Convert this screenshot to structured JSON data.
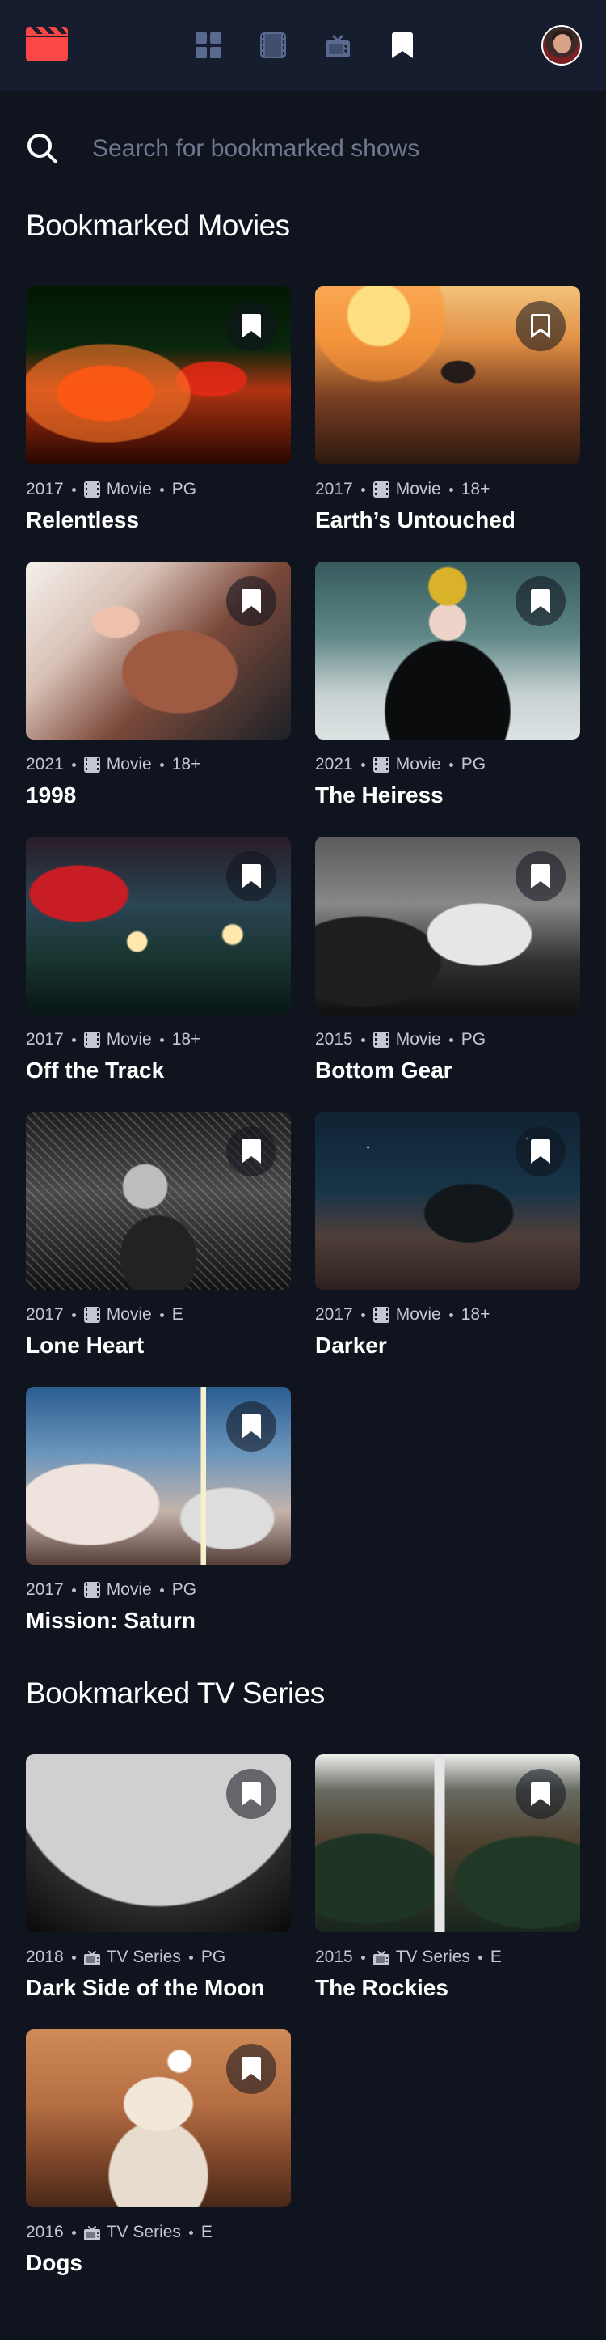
{
  "navigation": {
    "logo": "movie-app-logo",
    "items": [
      {
        "name": "home-icon",
        "active": false,
        "color": "#5A698F"
      },
      {
        "name": "movies-icon",
        "active": false,
        "color": "#5A698F"
      },
      {
        "name": "tv-series-icon",
        "active": false,
        "color": "#5A698F"
      },
      {
        "name": "bookmark-icon",
        "active": true,
        "color": "#FFFFFF"
      }
    ],
    "avatar": "profile-avatar"
  },
  "search": {
    "placeholder": "Search for bookmarked shows",
    "value": ""
  },
  "sections": {
    "movies_title": "Bookmarked Movies",
    "tv_title": "Bookmarked TV Series"
  },
  "cards": {
    "relentless": {
      "year": "2017",
      "category": "Movie",
      "rating": "PG",
      "title": "Relentless",
      "bookmarked": true
    },
    "earth": {
      "year": "2017",
      "category": "Movie",
      "rating": "18+",
      "title": "Earth’s Untouched",
      "bookmarked": true
    },
    "1998": {
      "year": "2021",
      "category": "Movie",
      "rating": "18+",
      "title": "1998",
      "bookmarked": true
    },
    "heiress": {
      "year": "2021",
      "category": "Movie",
      "rating": "PG",
      "title": "The Heiress",
      "bookmarked": true
    },
    "track": {
      "year": "2017",
      "category": "Movie",
      "rating": "18+",
      "title": "Off the Track",
      "bookmarked": true
    },
    "gear": {
      "year": "2015",
      "category": "Movie",
      "rating": "PG",
      "title": "Bottom Gear",
      "bookmarked": true
    },
    "lone": {
      "year": "2017",
      "category": "Movie",
      "rating": "E",
      "title": "Lone Heart",
      "bookmarked": true
    },
    "darker": {
      "year": "2017",
      "category": "Movie",
      "rating": "18+",
      "title": "Darker",
      "bookmarked": true
    },
    "saturn": {
      "year": "2017",
      "category": "Movie",
      "rating": "PG",
      "title": "Mission: Saturn",
      "bookmarked": true
    },
    "moon": {
      "year": "2018",
      "category": "TV Series",
      "rating": "PG",
      "title": "Dark Side of the Moon",
      "bookmarked": true
    },
    "rockies": {
      "year": "2015",
      "category": "TV Series",
      "rating": "E",
      "title": "The Rockies",
      "bookmarked": true
    },
    "dogs": {
      "year": "2016",
      "category": "TV Series",
      "rating": "E",
      "title": "Dogs",
      "bookmarked": true
    }
  },
  "colors": {
    "background": "#10141E",
    "navbar": "#161D2F",
    "accent": "#FC4747",
    "muted_text": "#C4C8D2"
  }
}
